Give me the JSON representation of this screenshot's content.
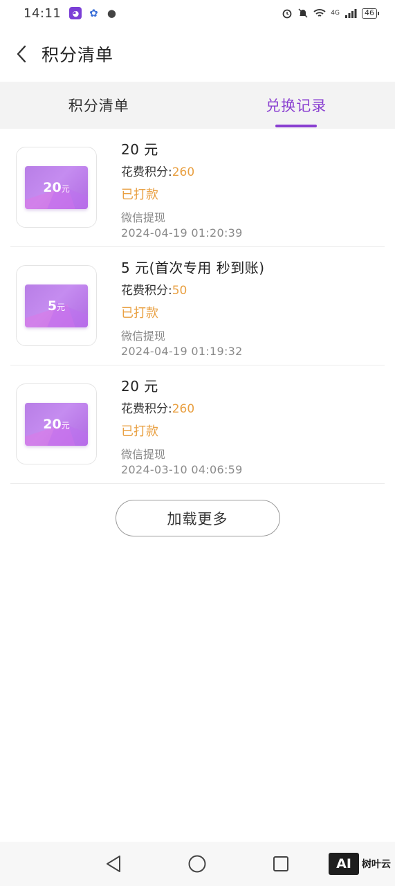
{
  "status_bar": {
    "time": "14:11",
    "network": "4G",
    "battery": "46",
    "apps": [
      "cat-app-icon",
      "paw-app-icon",
      "wechat-icon"
    ]
  },
  "header": {
    "title": "积分清单"
  },
  "tabs": [
    {
      "label": "积分清单",
      "active": false
    },
    {
      "label": "兑换记录",
      "active": true
    }
  ],
  "records": [
    {
      "card_amount": "20",
      "card_unit": "元",
      "title": "20 元",
      "cost_label": "花费积分:",
      "cost_value": "260",
      "status": "已打款",
      "method": "微信提现",
      "time": "2024-04-19 01:20:39"
    },
    {
      "card_amount": "5",
      "card_unit": "元",
      "title": "5 元(首次专用 秒到账)",
      "cost_label": "花费积分:",
      "cost_value": "50",
      "status": "已打款",
      "method": "微信提现",
      "time": "2024-04-19 01:19:32"
    },
    {
      "card_amount": "20",
      "card_unit": "元",
      "title": "20 元",
      "cost_label": "花费积分:",
      "cost_value": "260",
      "status": "已打款",
      "method": "微信提现",
      "time": "2024-03-10 04:06:59"
    }
  ],
  "load_more": "加载更多",
  "watermark": {
    "logo": "AI",
    "text": "树叶云"
  },
  "colors": {
    "accent": "#8a3fd1",
    "highlight": "#e9a042",
    "muted": "#8a8a8a"
  }
}
